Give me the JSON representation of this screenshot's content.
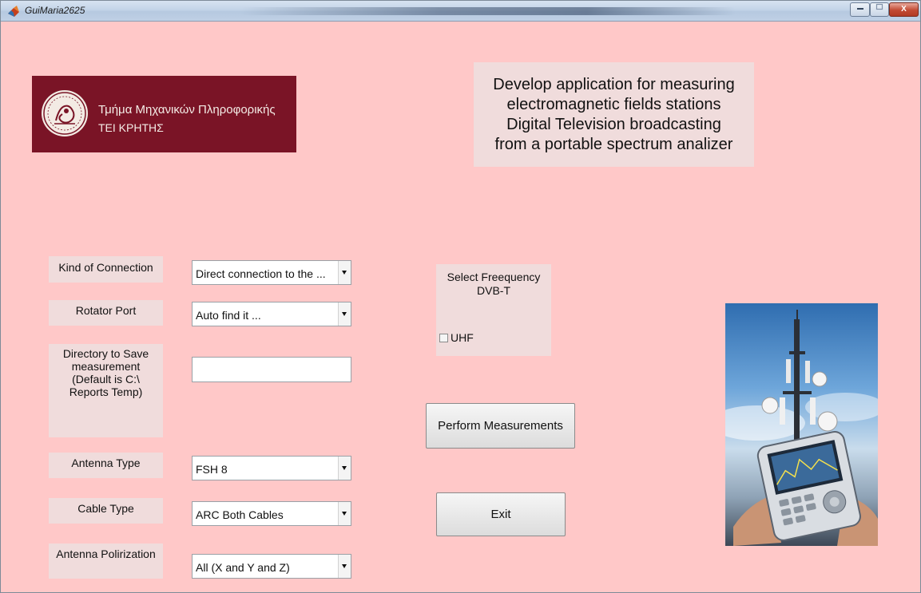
{
  "window": {
    "title": "GuiMaria2625",
    "controls": {
      "minimize": "",
      "maximize": "",
      "close": "X"
    }
  },
  "logo": {
    "line1": "Τμήμα Μηχανικών Πληροφορικής",
    "line2": "ΤΕΙ ΚΡΗΤΗΣ"
  },
  "header": {
    "text": "Develop application for measuring\nelectromagnetic fields stations\nDigital Television broadcasting\nfrom a portable spectrum analizer"
  },
  "form": {
    "connection": {
      "label": "Kind of Connection",
      "value": "Direct connection to the ..."
    },
    "rotator_port": {
      "label": "Rotator Port",
      "value": "Auto find it ..."
    },
    "directory": {
      "label": "Directory to Save\nmeasurement\n(Default is C:\\\nReports Temp)",
      "value": ""
    },
    "antenna_type": {
      "label": "Antenna Type",
      "value": "FSH 8"
    },
    "cable_type": {
      "label": "Cable Type",
      "value": "ARC Both Cables"
    },
    "polarization": {
      "label": "Antenna Polirization",
      "value": "All (X and Y and Z)"
    }
  },
  "frequency": {
    "title": "Select Freequency\nDVB-T",
    "uhf_label": "UHF",
    "uhf_checked": false
  },
  "buttons": {
    "perform": "Perform Measurements",
    "exit": "Exit"
  },
  "icons": {
    "app": "matlab-icon",
    "seal": "university-seal-icon",
    "dropdown": "chevron-down-icon"
  },
  "colors": {
    "background": "#ffc8c8",
    "panel": "#f0dcdc",
    "logo_bg": "#7a1426"
  }
}
